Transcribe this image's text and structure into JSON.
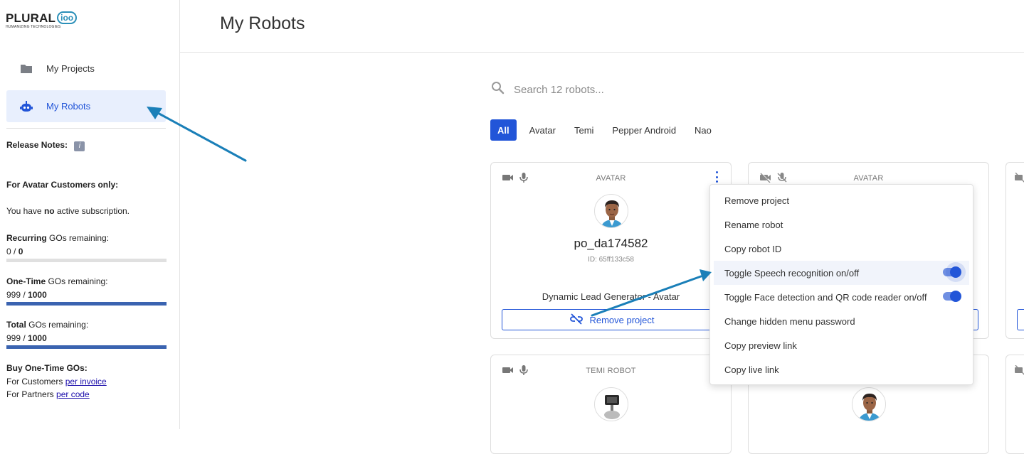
{
  "sidebar": {
    "logo": {
      "text": "PLURAL",
      "mark": "ioo",
      "tagline": "HUMANIZING TECHNOLOGIES"
    },
    "nav": [
      {
        "label": "My Projects",
        "icon": "folder-icon"
      },
      {
        "label": "My Robots",
        "icon": "robot-icon",
        "active": true
      }
    ],
    "release_notes_label": "Release Notes:",
    "info_icon": "i",
    "avatar_customers_heading": "For Avatar Customers only:",
    "subscription": {
      "prefix": "You have",
      "emph": "no",
      "suffix": "active subscription."
    },
    "recurring": {
      "label_bold": "Recurring",
      "label_rest": "GOs remaining:",
      "used": "0",
      "total": "0",
      "fraction": 0
    },
    "onetime": {
      "label_bold": "One-Time",
      "label_rest": "GOs remaining:",
      "used": "999",
      "total": "1000",
      "fraction": 0.999
    },
    "totalgos": {
      "label_bold": "Total",
      "label_rest": "GOs remaining:",
      "used": "999",
      "total": "1000",
      "fraction": 0.999
    },
    "buy": {
      "heading": "Buy One-Time GOs:",
      "customers_prefix": "For Customers",
      "customers_link": "per invoice",
      "partners_prefix": "For Partners",
      "partners_link": "per code"
    }
  },
  "header": {
    "title": "My Robots"
  },
  "search": {
    "placeholder": "Search 12 robots..."
  },
  "filters": [
    "All",
    "Avatar",
    "Temi",
    "Pepper Android",
    "Nao"
  ],
  "cards": [
    {
      "type": "AVATAR",
      "name": "po_da174582",
      "id": "ID: 65ff133c58",
      "project": "Dynamic Lead Generator - Avatar",
      "button": "Remove project"
    },
    {
      "type": "AVATAR"
    },
    {
      "type": "TEMI ROBOT"
    }
  ],
  "context_menu": {
    "items": [
      {
        "label": "Remove project"
      },
      {
        "label": "Rename robot"
      },
      {
        "label": "Copy robot ID"
      },
      {
        "label": "Toggle Speech recognition on/off",
        "toggle": true
      },
      {
        "label": "Toggle Face detection and QR code reader on/off",
        "toggle": true
      },
      {
        "label": "Change hidden menu password"
      },
      {
        "label": "Copy preview link"
      },
      {
        "label": "Copy live link"
      }
    ]
  },
  "colors": {
    "primary": "#2255d8",
    "annotation_arrow": "#1a7fb8",
    "progress": "#3a63b0"
  }
}
